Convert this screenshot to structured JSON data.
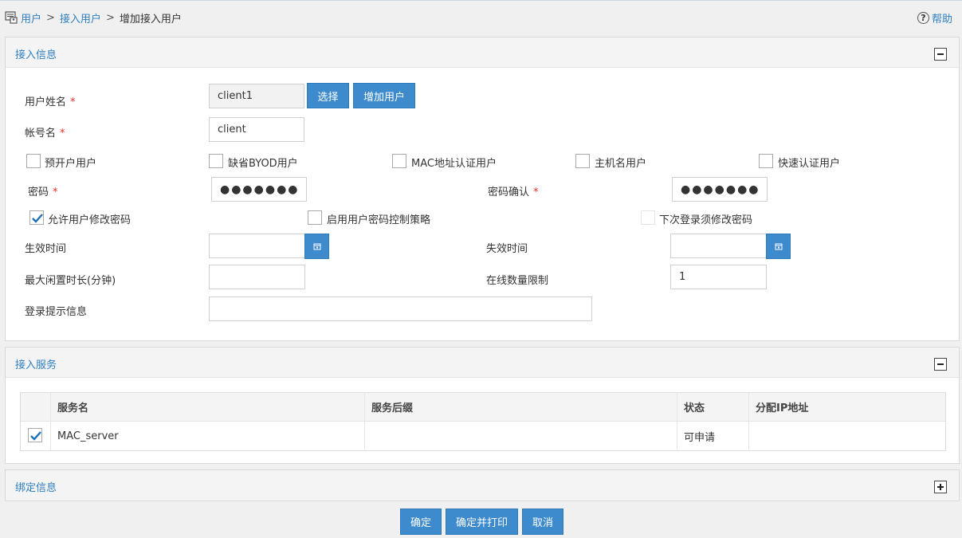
{
  "breadcrumb": {
    "item1": "用户",
    "item2": "接入用户",
    "current": "增加接入用户",
    "sep": ">"
  },
  "help": {
    "label": "帮助",
    "icon": "?"
  },
  "panels": {
    "access_info": {
      "title": "接入信息"
    },
    "access_service": {
      "title": "接入服务"
    },
    "binding_info": {
      "title": "绑定信息"
    }
  },
  "form": {
    "user_name_label": "用户姓名",
    "user_name_value": "client1",
    "select_button": "选择",
    "add_user_button": "增加用户",
    "account_label": "帐号名",
    "account_value": "client",
    "required_mark": "*",
    "checkboxes_row1": [
      {
        "label": "预开户用户",
        "checked": false
      },
      {
        "label": "缺省BYOD用户",
        "checked": false
      },
      {
        "label": "MAC地址认证用户",
        "checked": false
      },
      {
        "label": "主机名用户",
        "checked": false
      },
      {
        "label": "快速认证用户",
        "checked": false
      }
    ],
    "password_label": "密码",
    "password_value": "●●●●●●●",
    "password_confirm_label": "密码确认",
    "password_confirm_value": "●●●●●●●",
    "checkboxes_row2": [
      {
        "label": "允许用户修改密码",
        "checked": true
      },
      {
        "label": "启用用户密码控制策略",
        "checked": false
      },
      {
        "label": "下次登录须修改密码",
        "checked": false
      }
    ],
    "effective_time_label": "生效时间",
    "effective_time_value": "",
    "expire_time_label": "失效时间",
    "expire_time_value": "",
    "max_idle_label": "最大闲置时长(分钟)",
    "max_idle_value": "",
    "online_limit_label": "在线数量限制",
    "online_limit_value": "1",
    "login_prompt_label": "登录提示信息",
    "login_prompt_value": ""
  },
  "service_table": {
    "columns": [
      "服务名",
      "服务后缀",
      "状态",
      "分配IP地址"
    ],
    "rows": [
      {
        "checked": true,
        "name": "MAC_server",
        "suffix": "",
        "status": "可申请",
        "ip": ""
      }
    ]
  },
  "footer": {
    "confirm": "确定",
    "confirm_print": "确定并打印",
    "cancel": "取消"
  },
  "colors": {
    "accent": "#3d8bcd",
    "link": "#2f7fc0",
    "required": "#e0302a"
  }
}
